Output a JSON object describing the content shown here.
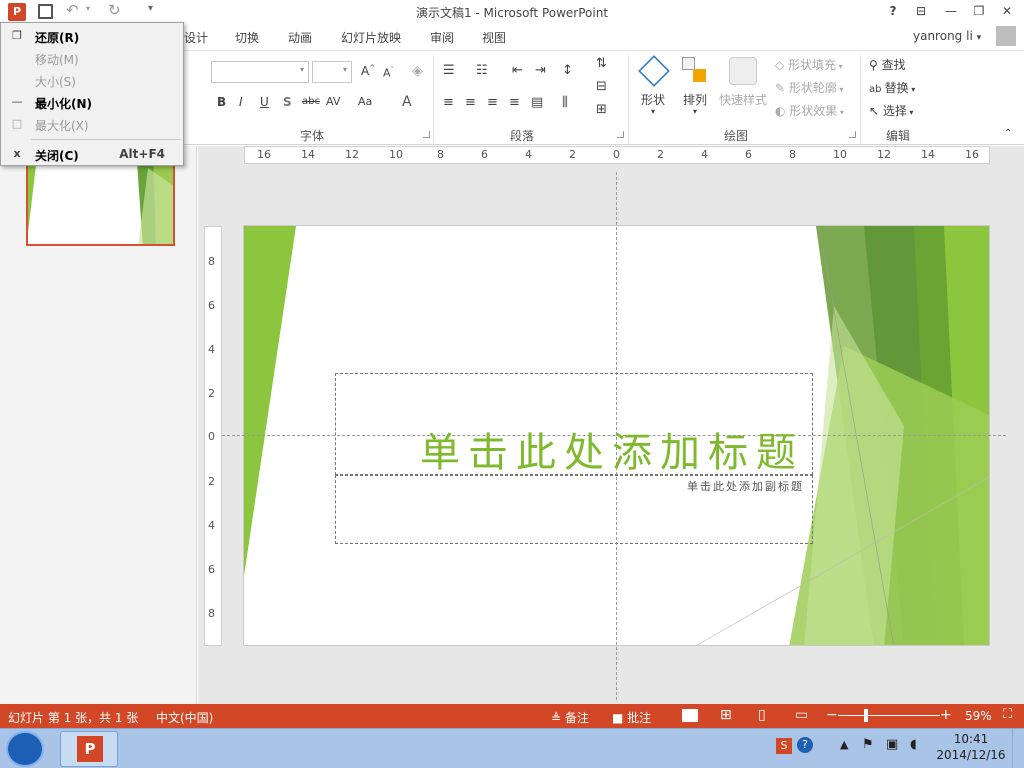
{
  "titlebar": {
    "title": "演示文稿1 - Microsoft PowerPoint",
    "help": "?",
    "ribbon_opts": "⊟",
    "minimize": "—",
    "restore": "❐",
    "close": "✕"
  },
  "tabs": {
    "items": [
      "设计",
      "切换",
      "动画",
      "幻灯片放映",
      "审阅",
      "视图"
    ],
    "user": "yanrong li"
  },
  "ribbon": {
    "font_group": "字体",
    "paragraph_group": "段落",
    "drawing_group": "绘图",
    "editing_group": "编辑",
    "shapes": "形状",
    "arrange": "排列",
    "quick_styles": "快速样式",
    "shape_fill": "形状填充",
    "shape_outline": "形状轮廓",
    "shape_effects": "形状效果",
    "find": "查找",
    "replace": "替换",
    "select": "选择",
    "bold": "B",
    "italic": "I",
    "underline": "U",
    "shadow": "S",
    "strike": "abc",
    "spacing": "AV",
    "case": "Aa",
    "font_color": "A"
  },
  "system_menu": {
    "items": [
      {
        "label": "还原(R)",
        "icon": "❐",
        "shortcut": "",
        "enabled": true
      },
      {
        "label": "移动(M)",
        "icon": "",
        "shortcut": "",
        "enabled": false
      },
      {
        "label": "大小(S)",
        "icon": "",
        "shortcut": "",
        "enabled": false
      },
      {
        "label": "最小化(N)",
        "icon": "—",
        "shortcut": "",
        "enabled": true
      },
      {
        "label": "最大化(X)",
        "icon": "□",
        "shortcut": "",
        "enabled": false
      },
      {
        "label": "关闭(C)",
        "icon": "x",
        "shortcut": "Alt+F4",
        "enabled": true
      }
    ]
  },
  "ruler": {
    "h_labels": [
      "16",
      "14",
      "12",
      "10",
      "8",
      "6",
      "4",
      "2",
      "0",
      "2",
      "4",
      "6",
      "8",
      "10",
      "12",
      "14",
      "16"
    ],
    "v_labels": [
      "8",
      "6",
      "4",
      "2",
      "0",
      "2",
      "4",
      "6",
      "8"
    ]
  },
  "slide": {
    "title_placeholder": "单击此处添加标题",
    "subtitle_placeholder": "单击此处添加副标题"
  },
  "statusbar": {
    "slide_info": "幻灯片 第 1 张，共 1 张",
    "language": "中文(中国)",
    "notes": "备注",
    "comments": "批注",
    "zoom": "59%"
  },
  "taskbar": {
    "time": "10:41",
    "date": "2014/12/16"
  },
  "colors": {
    "accent": "#d24726",
    "green": "#7fba2e",
    "dark_green": "#4e8a2a"
  }
}
